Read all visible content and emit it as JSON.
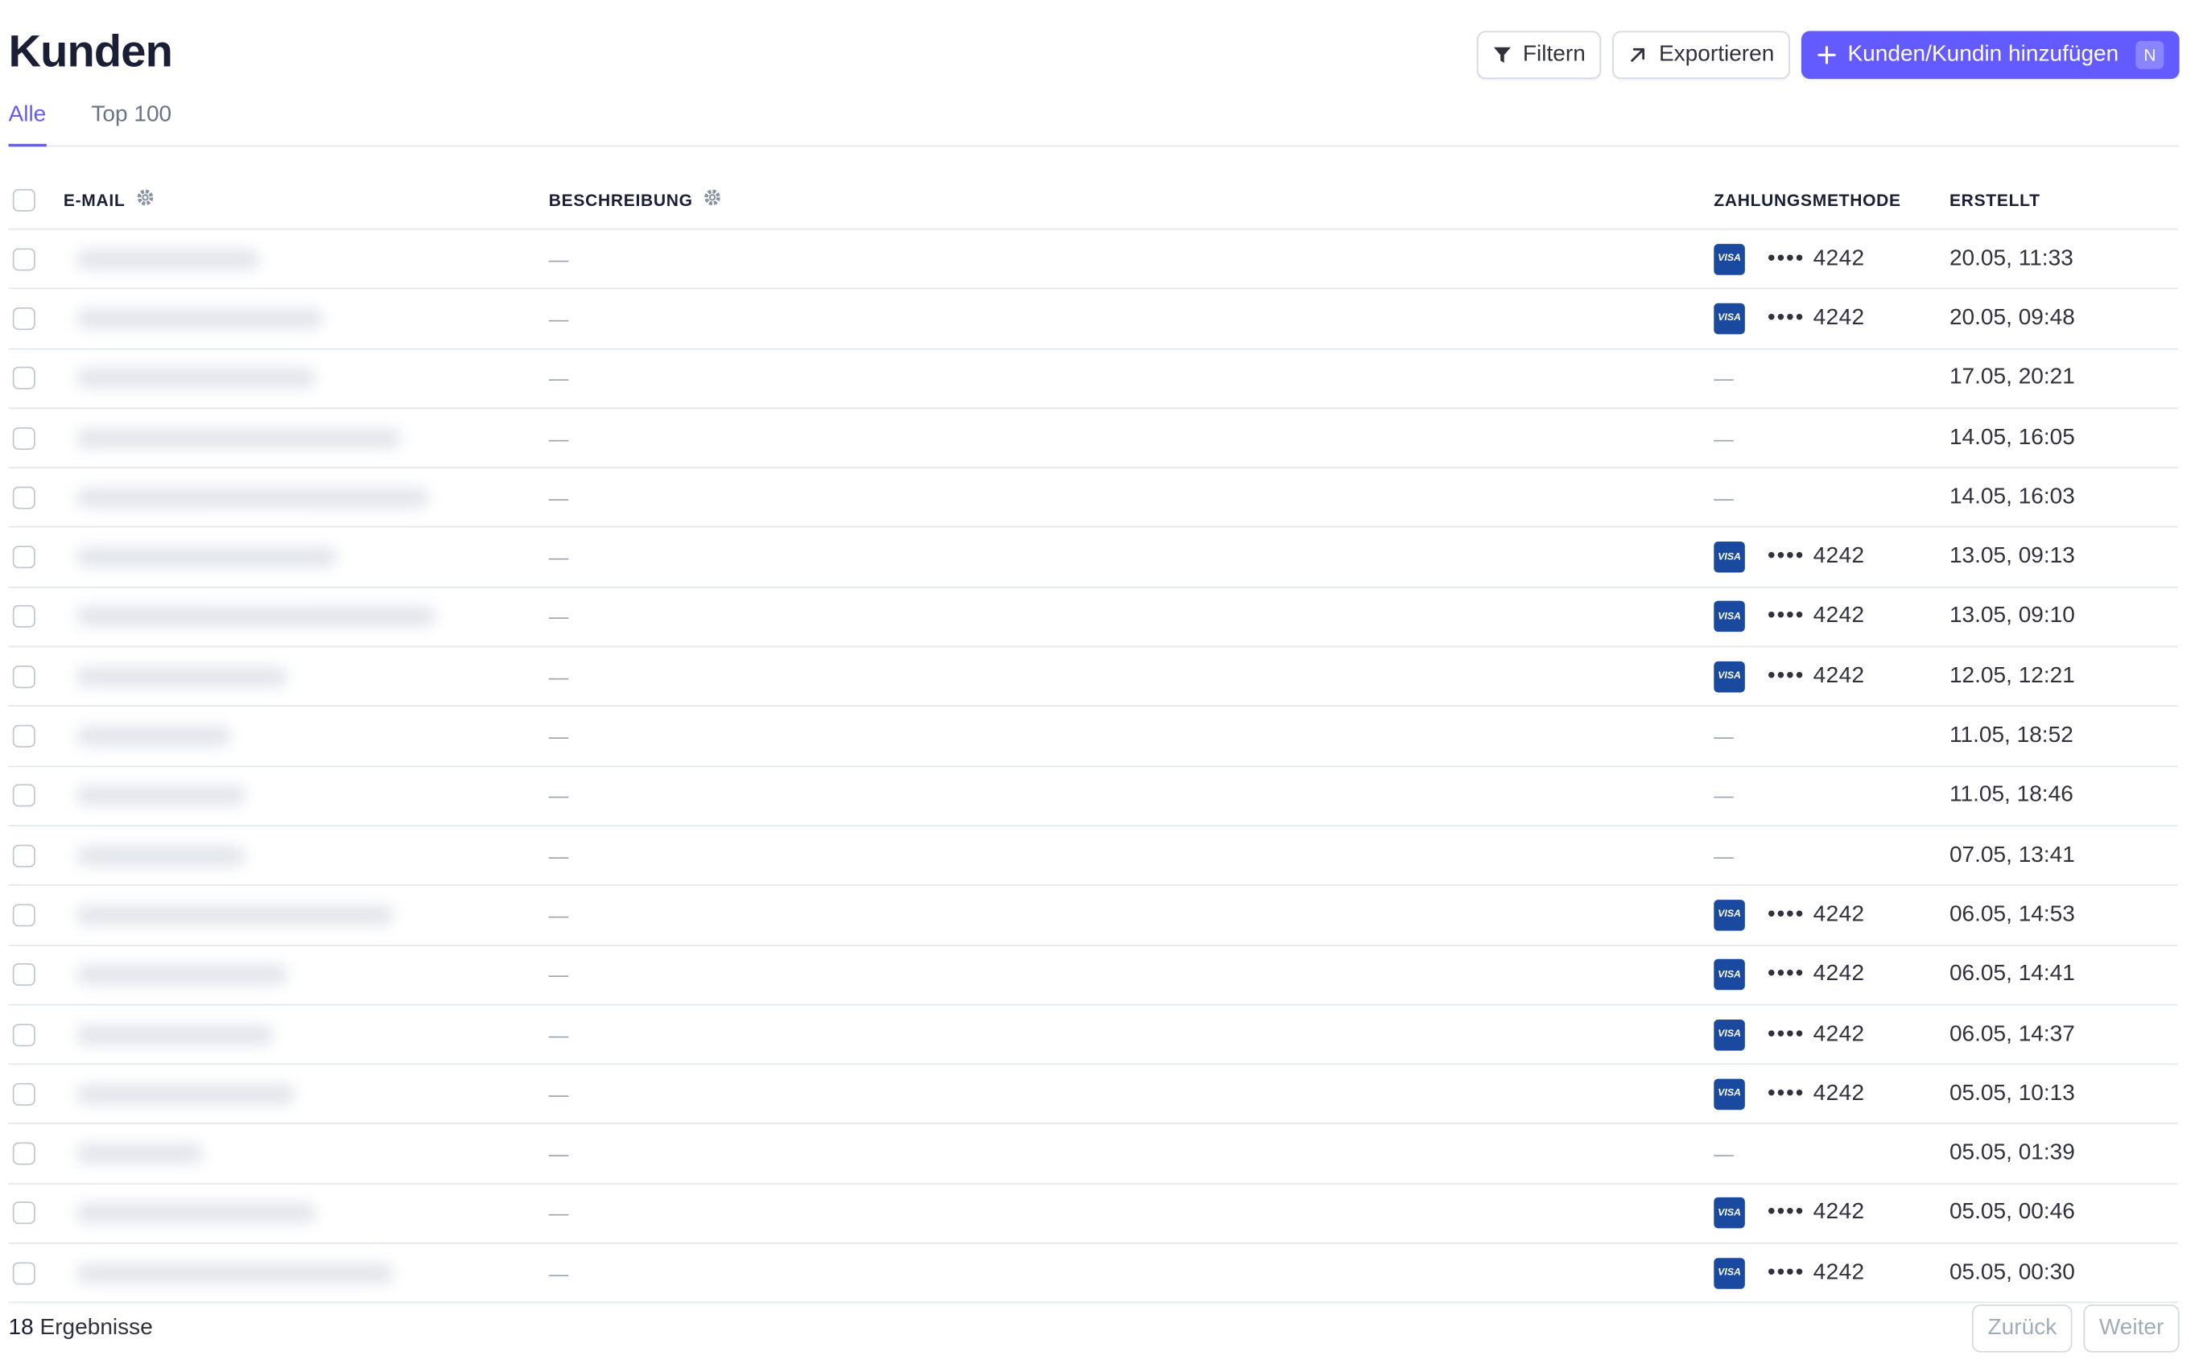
{
  "header": {
    "title": "Kunden",
    "actions": {
      "filter_label": "Filtern",
      "export_label": "Exportieren",
      "add_label": "Kunden/Kundin hinzufügen",
      "add_shortcut": "N"
    }
  },
  "tabs": [
    {
      "label": "Alle",
      "active": true
    },
    {
      "label": "Top 100",
      "active": false
    }
  ],
  "table": {
    "columns": {
      "email": "E-MAIL",
      "description": "BESCHREIBUNG",
      "payment_method": "ZAHLUNGSMETHODE",
      "created": "ERSTELLT"
    },
    "rows": [
      {
        "description": "—",
        "card_brand": "VISA",
        "last4_mask": "••••",
        "last4": "4242",
        "created": "20.05, 11:33"
      },
      {
        "description": "—",
        "card_brand": "VISA",
        "last4_mask": "••••",
        "last4": "4242",
        "created": "20.05, 09:48"
      },
      {
        "description": "—",
        "payment_method": "—",
        "created": "17.05, 20:21"
      },
      {
        "description": "—",
        "payment_method": "—",
        "created": "14.05, 16:05"
      },
      {
        "description": "—",
        "payment_method": "—",
        "created": "14.05, 16:03"
      },
      {
        "description": "—",
        "card_brand": "VISA",
        "last4_mask": "••••",
        "last4": "4242",
        "created": "13.05, 09:13"
      },
      {
        "description": "—",
        "card_brand": "VISA",
        "last4_mask": "••••",
        "last4": "4242",
        "created": "13.05, 09:10"
      },
      {
        "description": "—",
        "card_brand": "VISA",
        "last4_mask": "••••",
        "last4": "4242",
        "created": "12.05, 12:21"
      },
      {
        "description": "—",
        "payment_method": "—",
        "created": "11.05, 18:52"
      },
      {
        "description": "—",
        "payment_method": "—",
        "created": "11.05, 18:46"
      },
      {
        "description": "—",
        "payment_method": "—",
        "created": "07.05, 13:41"
      },
      {
        "description": "—",
        "card_brand": "VISA",
        "last4_mask": "••••",
        "last4": "4242",
        "created": "06.05, 14:53"
      },
      {
        "description": "—",
        "card_brand": "VISA",
        "last4_mask": "••••",
        "last4": "4242",
        "created": "06.05, 14:41"
      },
      {
        "description": "—",
        "card_brand": "VISA",
        "last4_mask": "••••",
        "last4": "4242",
        "created": "06.05, 14:37"
      },
      {
        "description": "—",
        "card_brand": "VISA",
        "last4_mask": "••••",
        "last4": "4242",
        "created": "05.05, 10:13"
      },
      {
        "description": "—",
        "payment_method": "—",
        "created": "05.05, 01:39"
      },
      {
        "description": "—",
        "card_brand": "VISA",
        "last4_mask": "••••",
        "last4": "4242",
        "created": "05.05, 00:46"
      },
      {
        "description": "—",
        "card_brand": "VISA",
        "last4_mask": "••••",
        "last4": "4242",
        "created": "05.05, 00:30"
      }
    ]
  },
  "footer": {
    "result_count": "18",
    "result_label": "Ergebnisse",
    "prev_label": "Zurück",
    "next_label": "Weiter"
  },
  "colors": {
    "accent": "#635bff",
    "visa": "#1a4aa0",
    "border": "#e3e8ee"
  },
  "icons": {
    "filter": "filter-icon",
    "export": "arrow-up-right-icon",
    "add": "plus-icon",
    "column_settings": "gear-icon",
    "card": "visa-icon"
  }
}
